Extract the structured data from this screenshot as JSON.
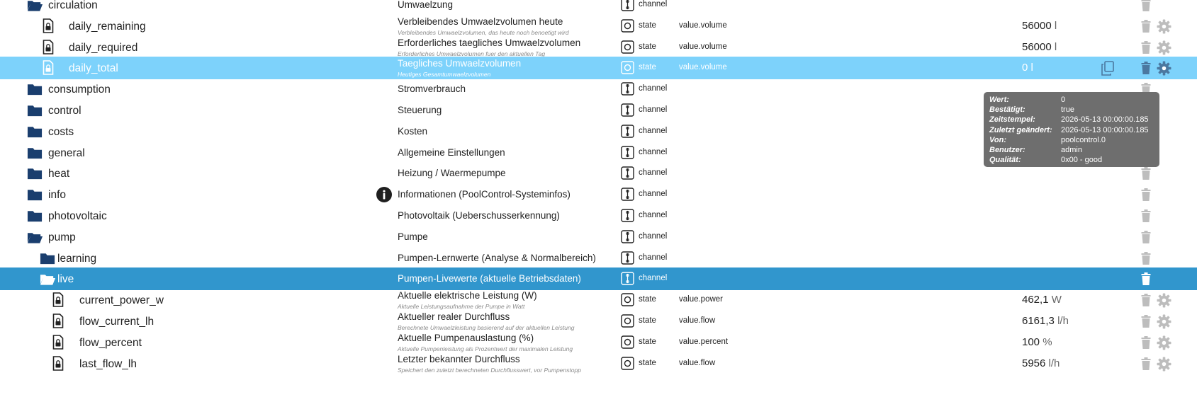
{
  "colors": {
    "folder": "#1a3e6e",
    "highlight_row": "#7dd2fb",
    "selected_row": "#3196cd",
    "icon_gray": "#bdbdbd",
    "tooltip_bg": "#6e6e6e"
  },
  "rows": [
    {
      "name": "circulation",
      "icon": "folder-open-icon",
      "desc": "Umwaelzung",
      "descDetail": "",
      "typeIcon": "channel-icon",
      "type": "channel",
      "role": "",
      "value": "",
      "unit": "",
      "state": "normal"
    },
    {
      "name": "daily_remaining",
      "icon": "state-lock-icon",
      "desc": "Verbleibendes Umwaelzvolumen heute",
      "descDetail": "Verbleibendes Umwaelzvolumen, das heute noch benoetigt wird",
      "typeIcon": "state-icon",
      "type": "state",
      "role": "value.volume",
      "value": "56000",
      "unit": "l",
      "state": "normal"
    },
    {
      "name": "daily_required",
      "icon": "state-lock-icon",
      "desc": "Erforderliches taegliches Umwaelzvolumen",
      "descDetail": "Erforderliches Umwaelzvolumen fuer den aktuellen Tag",
      "typeIcon": "state-icon",
      "type": "state",
      "role": "value.volume",
      "value": "56000",
      "unit": "l",
      "state": "normal"
    },
    {
      "name": "daily_total",
      "icon": "state-lock-icon",
      "desc": "Taegliches Umwaelzvolumen",
      "descDetail": "Heutiges Gesamtumwaelzvolumen",
      "typeIcon": "state-icon",
      "type": "state",
      "role": "value.volume",
      "value": "0",
      "unit": "l",
      "state": "highlight"
    },
    {
      "name": "consumption",
      "icon": "folder-closed-icon",
      "desc": "Stromverbrauch",
      "descDetail": "",
      "typeIcon": "channel-icon",
      "type": "channel",
      "role": "",
      "value": "",
      "unit": "",
      "state": "normal"
    },
    {
      "name": "control",
      "icon": "folder-closed-icon",
      "desc": "Steuerung",
      "descDetail": "",
      "typeIcon": "channel-icon",
      "type": "channel",
      "role": "",
      "value": "",
      "unit": "",
      "state": "normal"
    },
    {
      "name": "costs",
      "icon": "folder-closed-icon",
      "desc": "Kosten",
      "descDetail": "",
      "typeIcon": "channel-icon",
      "type": "channel",
      "role": "",
      "value": "",
      "unit": "",
      "state": "normal"
    },
    {
      "name": "general",
      "icon": "folder-closed-icon",
      "desc": "Allgemeine Einstellungen",
      "descDetail": "",
      "typeIcon": "channel-icon",
      "type": "channel",
      "role": "",
      "value": "",
      "unit": "",
      "state": "normal"
    },
    {
      "name": "heat",
      "icon": "folder-closed-icon",
      "desc": "Heizung / Waermepumpe",
      "descDetail": "",
      "typeIcon": "channel-icon",
      "type": "channel",
      "role": "",
      "value": "",
      "unit": "",
      "state": "normal"
    },
    {
      "name": "info",
      "icon": "folder-closed-icon",
      "desc": "Informationen (PoolControl-Systeminfos)",
      "descDetail": "",
      "typeIcon": "channel-icon",
      "type": "channel",
      "role": "",
      "value": "",
      "unit": "",
      "state": "normal",
      "infoIcon": "info-circle-icon"
    },
    {
      "name": "photovoltaic",
      "icon": "folder-closed-icon",
      "desc": "Photovoltaik (Ueberschusserkennung)",
      "descDetail": "",
      "typeIcon": "channel-icon",
      "type": "channel",
      "role": "",
      "value": "",
      "unit": "",
      "state": "normal"
    },
    {
      "name": "pump",
      "icon": "folder-open-icon",
      "desc": "Pumpe",
      "descDetail": "",
      "typeIcon": "channel-icon",
      "type": "channel",
      "role": "",
      "value": "",
      "unit": "",
      "state": "normal"
    },
    {
      "name": "learning",
      "icon": "folder-closed-icon",
      "desc": "Pumpen-Lernwerte (Analyse & Normalbereich)",
      "descDetail": "",
      "typeIcon": "channel-icon",
      "type": "channel",
      "role": "",
      "value": "",
      "unit": "",
      "state": "normal"
    },
    {
      "name": "live",
      "icon": "folder-open-icon",
      "desc": "Pumpen-Livewerte (aktuelle Betriebsdaten)",
      "descDetail": "",
      "typeIcon": "channel-icon",
      "type": "channel",
      "role": "",
      "value": "",
      "unit": "",
      "state": "selected"
    },
    {
      "name": "current_power_w",
      "icon": "state-lock-icon",
      "desc": "Aktuelle elektrische Leistung (W)",
      "descDetail": "Aktuelle Leistungsaufnahme der Pumpe in Watt",
      "typeIcon": "state-icon",
      "type": "state",
      "role": "value.power",
      "value": "462,1",
      "unit": "W",
      "state": "normal"
    },
    {
      "name": "flow_current_lh",
      "icon": "state-lock-icon",
      "desc": "Aktueller realer Durchfluss",
      "descDetail": "Berechnete Umwaelzleistung basierend auf der aktuellen Leistung",
      "typeIcon": "state-icon",
      "type": "state",
      "role": "value.flow",
      "value": "6161,3",
      "unit": "l/h",
      "state": "normal"
    },
    {
      "name": "flow_percent",
      "icon": "state-lock-icon",
      "desc": "Aktuelle Pumpenauslastung (%)",
      "descDetail": "Aktuelle Pumpenleistung als Prozentwert der maximalen Leistung",
      "typeIcon": "state-icon",
      "type": "state",
      "role": "value.percent",
      "value": "100",
      "unit": "%",
      "state": "normal"
    },
    {
      "name": "last_flow_lh",
      "icon": "state-lock-icon",
      "desc": "Letzter bekannter Durchfluss",
      "descDetail": "Speichert den zuletzt berechneten Durchflusswert, vor Pumpenstopp",
      "typeIcon": "state-icon",
      "type": "state",
      "role": "value.flow",
      "value": "5956",
      "unit": "l/h",
      "state": "normal"
    }
  ],
  "tooltip": [
    {
      "key": "Wert:",
      "value": "0"
    },
    {
      "key": "Bestätigt:",
      "value": "true"
    },
    {
      "key": "Zeitstempel:",
      "value": "2026-05-13 00:00:00.185"
    },
    {
      "key": "Zuletzt geändert:",
      "value": "2026-05-13 00:00:00.185"
    },
    {
      "key": "Von:",
      "value": "poolcontrol.0"
    },
    {
      "key": "Benutzer:",
      "value": "admin"
    },
    {
      "key": "Qualität:",
      "value": "0x00 - good"
    }
  ]
}
